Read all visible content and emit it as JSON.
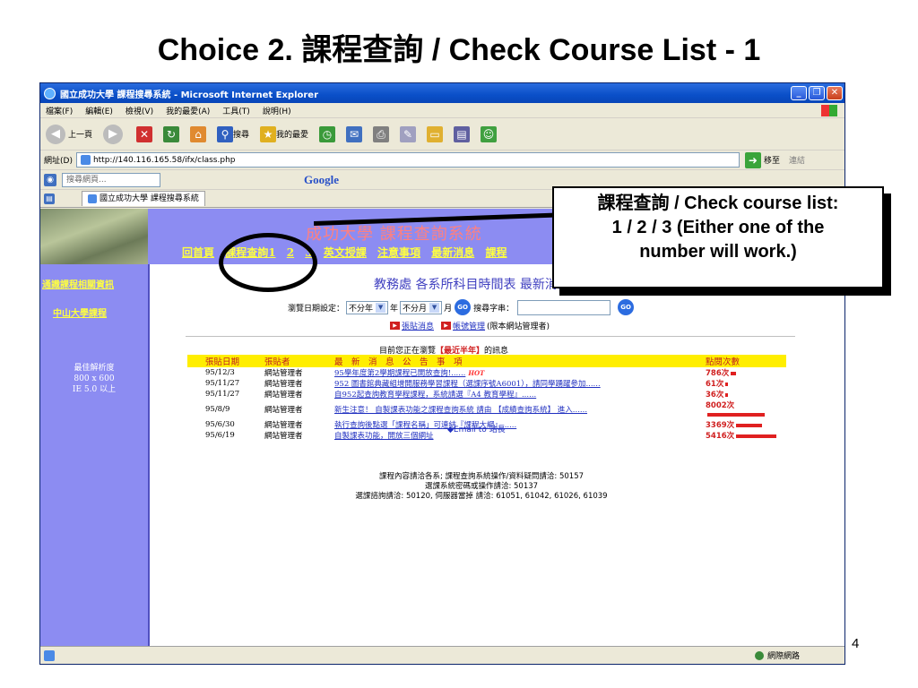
{
  "slide": {
    "title": "Choice 2. 課程查詢 / Check Course List - 1",
    "page_number": "4"
  },
  "browser": {
    "window_title": "國立成功大學 課程搜尋系統 - Microsoft Internet Explorer",
    "menu": [
      "檔案(F)",
      "編輯(E)",
      "檢視(V)",
      "我的最愛(A)",
      "工具(T)",
      "說明(H)"
    ],
    "toolbar": {
      "back": "上一頁",
      "search": "搜尋",
      "favorites": "我的最愛"
    },
    "address": {
      "label": "網址(D)",
      "url": "http://140.116.165.58/ifx/class.php",
      "go": "移至",
      "links": "連結"
    },
    "google_bar": {
      "search_placeholder": "搜尋網頁...",
      "logo": "Google"
    },
    "tab": "國立成功大學 課程搜尋系統",
    "status_zone": "網際網路"
  },
  "site": {
    "banner_title": "成功大學 課程查詢系統",
    "nav": [
      "回首頁",
      "課程查詢1",
      "2",
      "3",
      "英文授課",
      "注意事項",
      "最新消息",
      "課程"
    ],
    "sidebar": {
      "link1": "通識課程相關資訊",
      "link2": "中山大學課程",
      "info_title": "最佳解析度",
      "info_res": "800 x 600",
      "info_ie": "IE 5.0 以上"
    },
    "section_title": "教務處 各系所科目時間表 最新消息",
    "browse": {
      "label": "瀏覽日期設定：",
      "year_value": "不分年",
      "year_unit": "年",
      "month_value": "不分月",
      "month_unit": "月",
      "go": "GO",
      "keyword_label": "搜尋字串："
    },
    "links": {
      "post": "張貼消息",
      "account": "帳號管理",
      "account_note": "(限本網站管理者)"
    },
    "view_note_prefix": "目前您正在瀏覽",
    "view_note_range": "【最近半年】",
    "view_note_suffix": "的訊息",
    "table": {
      "headers": [
        "張貼日期",
        "張貼者",
        "最　新　消　息　公　告　事　項",
        "點閱次數"
      ],
      "rows": [
        {
          "date": "95/12/3",
          "by": "網站管理者",
          "title": "95學年度第2學期課程已開放查詢!......",
          "hot": "HOT",
          "hits": "786次",
          "bar": 0.02
        },
        {
          "date": "95/11/27",
          "by": "網站管理者",
          "title": "952 圖書館典藏組增開服務學習課程（選課序號A6001），請同學踴躍參加......",
          "hot": "",
          "hits": "61次",
          "bar": 0.005
        },
        {
          "date": "95/11/27",
          "by": "網站管理者",
          "title": "自952起查詢教育學程課程，系統請選『A4 教育學程』......",
          "hot": "",
          "hits": "36次",
          "bar": 0.003
        },
        {
          "date": "95/8/9",
          "by": "網站管理者",
          "title": "新生注意！ 自製課表功能之課程查詢系統 請由 【成績查詢系統】 進入......",
          "hot": "",
          "hits": "8002次",
          "bar": 0.2
        },
        {
          "date": "95/6/30",
          "by": "網站管理者",
          "title": "執行查詢後點選「課程名稱」可連結『課程大綱』......",
          "hot": "",
          "hits": "3369次",
          "bar": 0.09
        },
        {
          "date": "95/6/19",
          "by": "網站管理者",
          "title": "自製課表功能，開放三個網址",
          "hot": "",
          "hits": "5416次",
          "bar": 0.14
        }
      ]
    },
    "email": "◆Email to 站長",
    "contact": [
      "課程內容請洽各系; 課程查詢系統操作/資料疑問請洽: 50157",
      "選課系統密碼或操作請洽: 50137",
      "選課諮詢請洽: 50120, 伺服器當掉 請洽: 61051, 61042, 61026, 61039"
    ]
  },
  "callout": {
    "line1": "課程查詢 / Check course list:",
    "line2": "1 / 2 / 3 (Either one of the",
    "line3": "number will work.)"
  }
}
